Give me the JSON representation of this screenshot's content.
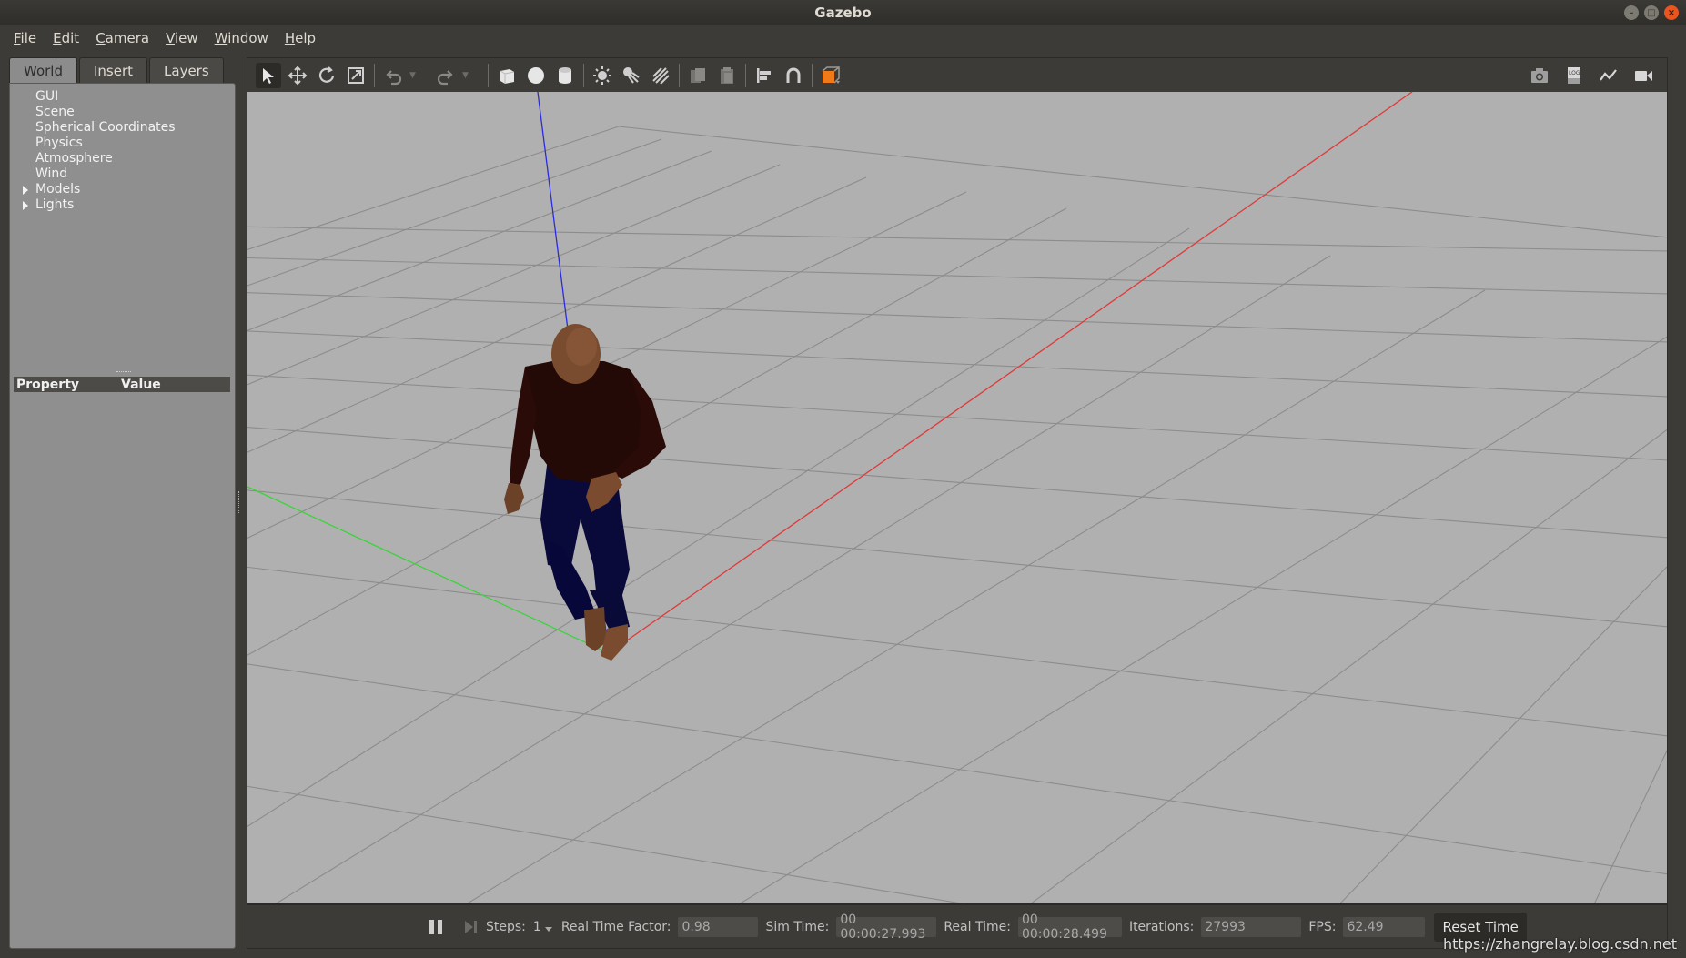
{
  "window": {
    "title": "Gazebo"
  },
  "menu": [
    {
      "label": "File",
      "u": "F",
      "rest": "ile"
    },
    {
      "label": "Edit",
      "u": "E",
      "rest": "dit"
    },
    {
      "label": "Camera",
      "u": "C",
      "rest": "amera"
    },
    {
      "label": "View",
      "u": "V",
      "rest": "iew"
    },
    {
      "label": "Window",
      "u": "W",
      "rest": "indow"
    },
    {
      "label": "Help",
      "u": "H",
      "rest": "elp"
    }
  ],
  "left_panel": {
    "tabs": [
      "World",
      "Insert",
      "Layers"
    ],
    "active_tab": "World",
    "tree": [
      {
        "label": "GUI",
        "expandable": false
      },
      {
        "label": "Scene",
        "expandable": false
      },
      {
        "label": "Spherical Coordinates",
        "expandable": false
      },
      {
        "label": "Physics",
        "expandable": false
      },
      {
        "label": "Atmosphere",
        "expandable": false
      },
      {
        "label": "Wind",
        "expandable": false
      },
      {
        "label": "Models",
        "expandable": true
      },
      {
        "label": "Lights",
        "expandable": true
      }
    ],
    "property_header": {
      "property": "Property",
      "value": "Value"
    }
  },
  "toolbar": {
    "left_icons": [
      "select-icon",
      "translate-icon",
      "rotate-icon",
      "scale-icon",
      "undo-icon",
      "redo-icon",
      "box-icon",
      "sphere-icon",
      "cylinder-icon",
      "point-light-icon",
      "spot-light-icon",
      "directional-light-icon",
      "copy-icon",
      "paste-icon",
      "align-icon",
      "snap-icon",
      "view-angle-icon"
    ],
    "right_icons": [
      "screenshot-icon",
      "log-icon",
      "plot-icon",
      "record-video-icon"
    ]
  },
  "status": {
    "steps_label": "Steps:",
    "steps_value": "1",
    "rtf_label": "Real Time Factor:",
    "rtf_value": "0.98",
    "sim_time_label": "Sim Time:",
    "sim_time_value": "00 00:00:27.993",
    "real_time_label": "Real Time:",
    "real_time_value": "00 00:00:28.499",
    "iterations_label": "Iterations:",
    "iterations_value": "27993",
    "fps_label": "FPS:",
    "fps_value": "62.49",
    "reset_label": "Reset Time"
  },
  "watermark": "https://zhangrelay.blog.csdn.net",
  "colors": {
    "x_axis": "#e03a3a",
    "y_axis": "#3ad43a",
    "z_axis": "#2a2ae0",
    "ground": "#b0b0b0",
    "grid": "#8e8e8e"
  }
}
